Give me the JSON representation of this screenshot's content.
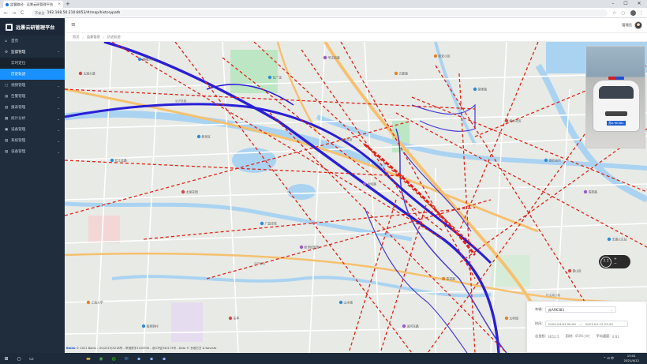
{
  "browser": {
    "tab_title": "监督路径 · 远景云研管理平台",
    "close_tab": "×",
    "new_tab": "+",
    "security_label": "不安全",
    "url": "192.168.50.210:8053/#/map/historypath",
    "back": "←",
    "forward": "→",
    "reload": "C",
    "star": "☆",
    "menu": "⋮",
    "win_min": "–",
    "win_max": "☐",
    "win_close": "✕"
  },
  "sidebar": {
    "brand": "远景云研管理平台",
    "items": [
      {
        "label": "首页",
        "icon": "home-icon",
        "glyph": "⌂",
        "has_children": false
      },
      {
        "label": "监督管理",
        "icon": "gear-icon",
        "glyph": "⚙",
        "has_children": true,
        "open": true
      },
      {
        "label": "实时定位",
        "icon": "",
        "glyph": "",
        "sub": true
      },
      {
        "label": "历史轨迹",
        "icon": "",
        "glyph": "",
        "sub": true,
        "active": true
      },
      {
        "label": "视频管理",
        "icon": "video-icon",
        "glyph": "▢",
        "has_children": true
      },
      {
        "label": "告警管理",
        "icon": "alarm-icon",
        "glyph": "▤",
        "has_children": true
      },
      {
        "label": "报表管理",
        "icon": "report-icon",
        "glyph": "▥",
        "has_children": true
      },
      {
        "label": "统计分析",
        "icon": "chart-icon",
        "glyph": "▦",
        "has_children": true
      },
      {
        "label": "设备管理",
        "icon": "device-icon",
        "glyph": "▣",
        "has_children": true
      },
      {
        "label": "系统管理",
        "icon": "system-icon",
        "glyph": "▧",
        "has_children": true
      },
      {
        "label": "设备管理",
        "icon": "settings-icon",
        "glyph": "▨",
        "has_children": true
      }
    ]
  },
  "header": {
    "menu_icon": "≡",
    "username": "管理员"
  },
  "breadcrumb": {
    "items": [
      "首页",
      "监督管理",
      "历史轨迹"
    ],
    "sep": "/"
  },
  "map": {
    "zoom_label": "7.7",
    "plus": "+",
    "minus": "−",
    "plate": "苏A·9K381",
    "copyright_brand": "Baidu",
    "copyright": "© 2021 Baidu - GS(2019)5218号 - 甲测资字1100930 - 京ICP证030173号 - Data © 长地万方 & Navinfo",
    "poi": [
      "锡梅大桥",
      "华庄街道",
      "新安小区",
      "长江北路",
      "太湖花园",
      "广益佳苑",
      "新世纪家园",
      "五爱路",
      "胡埭镇",
      "梅村社区",
      "锡北运河",
      "清扬路",
      "江南大学",
      "南泉新村",
      "东亭",
      "山水城",
      "运河东路",
      "太科园",
      "无锡火车站",
      "惠山区",
      "新吴区",
      "金城路",
      "青祁路",
      "长广溪",
      "太湖大道"
    ],
    "roads": [
      "锡澄高速",
      "京沪铁路",
      "沪宁城际",
      "环太湖公路"
    ]
  },
  "query_panel": {
    "vehicle_label": "车辆:",
    "vehicle_value": "苏A9K381",
    "dropdown_icon": "⌄",
    "time_label": "时间:",
    "time_start": "2020-04-01 00:00",
    "time_sep": "—",
    "time_end": "2021-04-12 23:59",
    "stats": [
      {
        "label": "总里程:",
        "value": "3652.5"
      },
      {
        "label": "用时:",
        "value": "4506小时"
      },
      {
        "label": "平均速度:",
        "value": "0.81"
      }
    ]
  },
  "taskbar": {
    "items": [
      "start-icon",
      "search-icon",
      "taskview-icon",
      "folder-icon",
      "chrome-icon",
      "wechat-icon",
      "mail-icon",
      "app-icon",
      "app-icon",
      "app-icon"
    ],
    "tray": "⌃ ⊡ 中",
    "time": "15:01",
    "date": "2021/4/12"
  },
  "colors": {
    "sidebar_bg": "#1f2d3d",
    "active_menu": "#1890ff",
    "track_solid": "#2a1fd6",
    "track_dashed": "#e02418",
    "highway": "#f5c16f",
    "water": "#aad3f2",
    "green": "#bde7c4"
  }
}
